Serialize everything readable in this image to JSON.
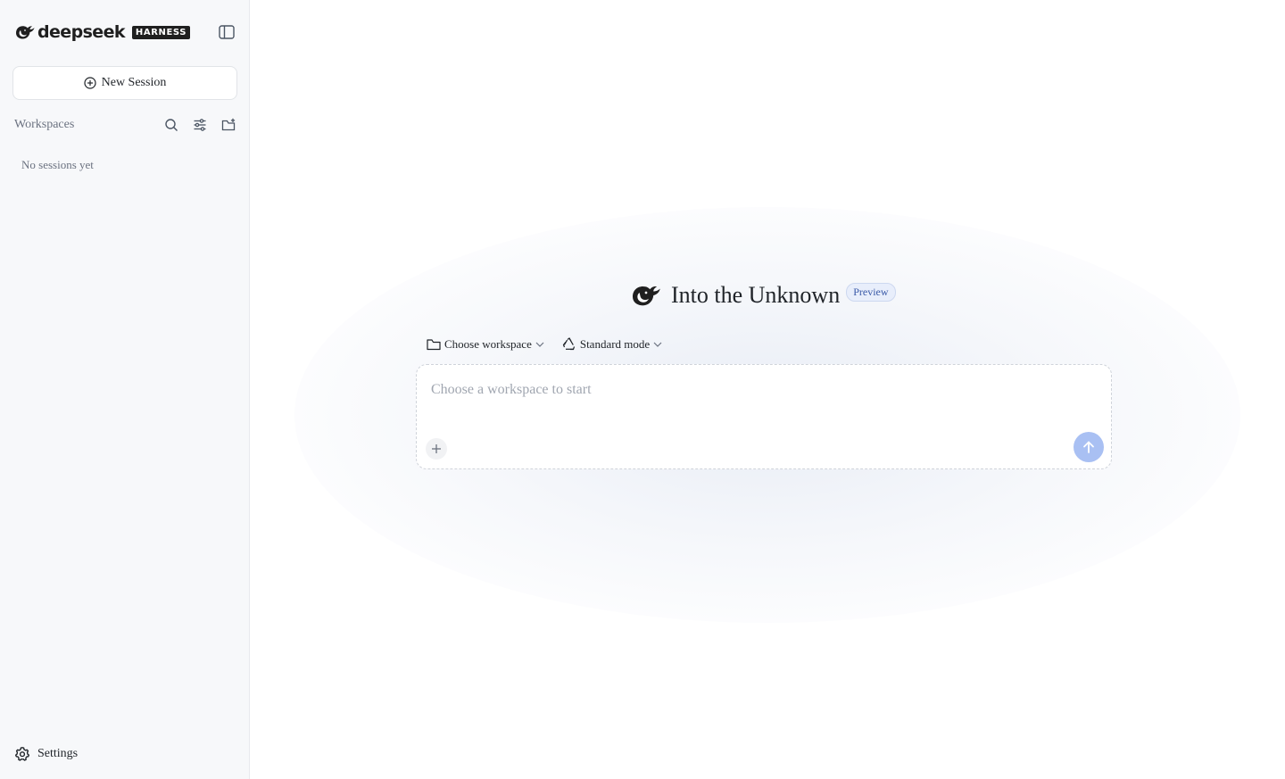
{
  "sidebar": {
    "brand_name": "deepseek",
    "brand_badge": "HARNESS",
    "new_session_label": "New Session",
    "workspaces_label": "Workspaces",
    "empty_label": "No sessions yet",
    "settings_label": "Settings"
  },
  "main": {
    "hero_title": "Into the Unknown",
    "preview_badge": "Preview",
    "workspace_selector": "Choose workspace",
    "mode_selector": "Standard mode",
    "composer_placeholder": "Choose a workspace to start"
  },
  "colors": {
    "sidebar_bg": "#f7f8fa",
    "send_button": "#a9c0f3",
    "preview_badge_bg": "#e8eefb",
    "preview_badge_text": "#3a5aa8"
  },
  "icons": {
    "brand": "whale-logo-icon",
    "collapse": "sidebar-toggle-icon",
    "new_session": "plus-circle-icon",
    "search": "search-icon",
    "filter": "sliders-icon",
    "new_folder": "folder-plus-icon",
    "settings": "gear-icon",
    "workspace": "folder-icon",
    "mode": "recycle-icon",
    "attach": "plus-icon",
    "send": "arrow-up-icon"
  }
}
